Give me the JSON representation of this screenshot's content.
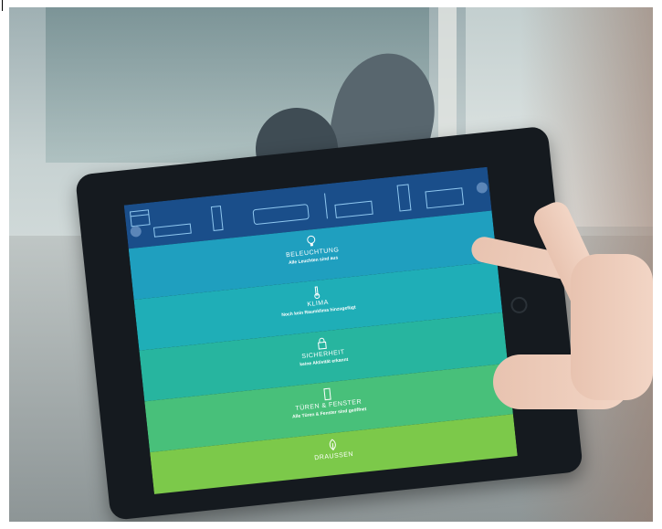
{
  "screen": {
    "sections": [
      {
        "title": "BELEUCHTUNG",
        "subtitle": "Alle Leuchten sind aus",
        "icon": "bulb-icon",
        "color": "#1f9fbf"
      },
      {
        "title": "KLIMA",
        "subtitle": "Noch kein Raumklima hinzugefügt",
        "icon": "thermometer-icon",
        "color": "#1faeb7"
      },
      {
        "title": "SICHERHEIT",
        "subtitle": "keine Aktivität erkannt",
        "icon": "lock-icon",
        "color": "#27b59f"
      },
      {
        "title": "TÜREN & FENSTER",
        "subtitle": "Alle Türen & Fenster sind geöffnet",
        "icon": "door-icon",
        "color": "#48c07a"
      },
      {
        "title": "DRAUSSEN",
        "subtitle": "",
        "icon": "leaf-icon",
        "color": "#7cc94a"
      }
    ],
    "topbar_color": "#1a4e8a"
  }
}
